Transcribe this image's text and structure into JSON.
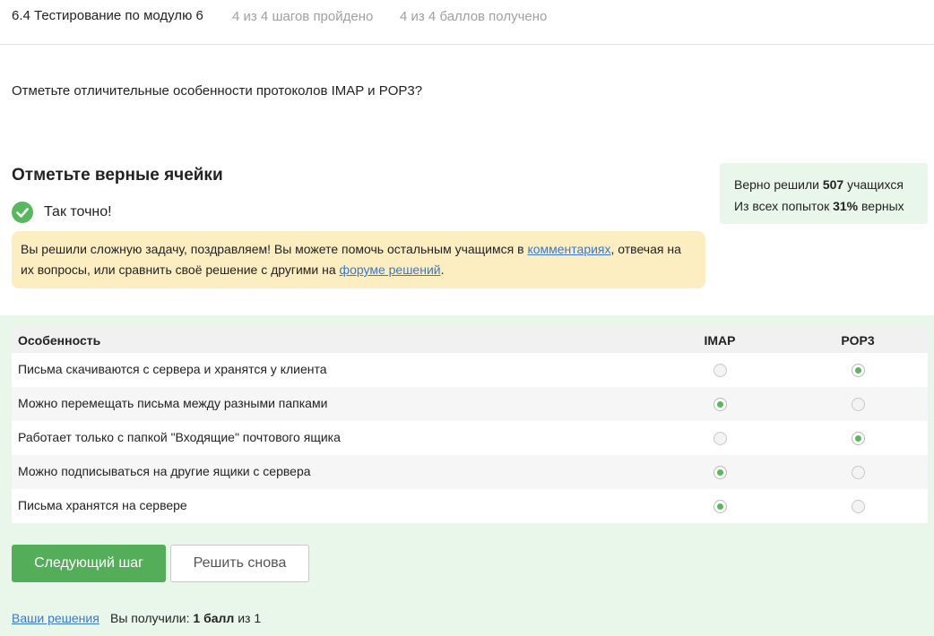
{
  "header": {
    "lesson_title": "6.4 Тестирование по модулю 6",
    "steps_progress": "4 из 4 шагов пройдено",
    "score_progress": "4 из 4 баллов  получено"
  },
  "question": {
    "text": "Отметьте отличительные особенности протоколов IMAP и POP3?"
  },
  "task": {
    "title": "Отметьте верные ячейки"
  },
  "stats": {
    "solved_prefix": "Верно решили ",
    "solved_count": "507",
    "solved_suffix": " учащихся",
    "attempts_prefix": "Из всех попыток ",
    "attempts_percent": "31%",
    "attempts_suffix": " верных"
  },
  "result": {
    "status_text": "Так точно!",
    "check_icon": "checkmark-icon",
    "status_color": "#59b85e"
  },
  "congrats": {
    "part1": "Вы решили сложную задачу, поздравляем! Вы можете помочь остальным учащимся в ",
    "link1": "комментариях",
    "part2": ", отвечая на их вопросы, или сравнить своё решение с другими на ",
    "link2": "форуме решений",
    "part3": "."
  },
  "table": {
    "header_feature": "Особенность",
    "columns": [
      "IMAP",
      "POP3"
    ],
    "rows": [
      {
        "label": "Письма скачиваются с сервера и хранятся у клиента",
        "imap": false,
        "pop3": true
      },
      {
        "label": "Можно перемещать письма между разными папками",
        "imap": true,
        "pop3": false
      },
      {
        "label": "Работает только с папкой \"Входящие\" почтового ящика",
        "imap": false,
        "pop3": true
      },
      {
        "label": "Можно подписываться на другие ящики с сервера",
        "imap": true,
        "pop3": false
      },
      {
        "label": "Письма хранятся на сервере",
        "imap": true,
        "pop3": false
      }
    ]
  },
  "buttons": {
    "next_label": "Следующий шаг",
    "retry_label": "Решить снова"
  },
  "footer": {
    "solutions_link": "Ваши решения",
    "score_prefix": "Вы получили: ",
    "score_value": "1 балл",
    "score_suffix": " из 1"
  },
  "colors": {
    "accent_green": "#54ad58",
    "panel_green": "#e9f7ea",
    "notice_yellow": "#fdeec2",
    "link_blue": "#3a78c9"
  }
}
